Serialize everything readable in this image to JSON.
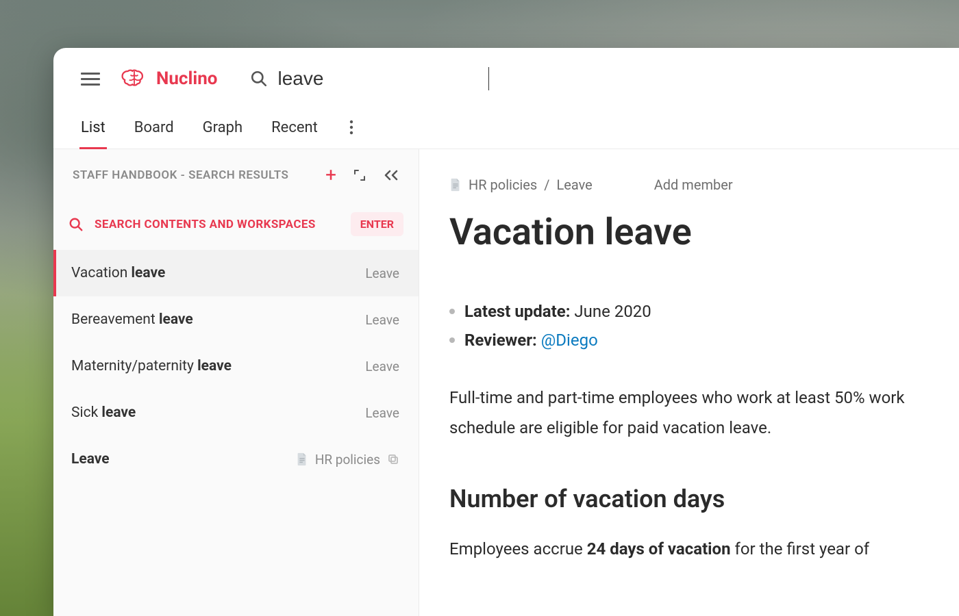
{
  "brand": {
    "name": "Nuclino"
  },
  "search": {
    "query": "leave"
  },
  "tabs": [
    "List",
    "Board",
    "Graph",
    "Recent"
  ],
  "active_tab_index": 0,
  "sidebar": {
    "header": "STAFF HANDBOOK - SEARCH RESULTS",
    "search_all_label": "SEARCH CONTENTS AND WORKSPACES",
    "enter_label": "ENTER",
    "results": [
      {
        "title_pre": "Vacation ",
        "title_bold": "leave",
        "crumb": "Leave",
        "active": true
      },
      {
        "title_pre": "Bereavement ",
        "title_bold": "leave",
        "crumb": "Leave",
        "active": false
      },
      {
        "title_pre": "Maternity/paternity ",
        "title_bold": "leave",
        "crumb": "Leave",
        "active": false
      },
      {
        "title_pre": "Sick ",
        "title_bold": "leave",
        "crumb": "Leave",
        "active": false
      },
      {
        "title_pre": "Leave",
        "title_bold": "",
        "crumb": "HR policies",
        "has_doc_icon": true,
        "has_copy_icon": true,
        "title_is_bold": true
      }
    ]
  },
  "document": {
    "breadcrumb": [
      "HR policies",
      "Leave"
    ],
    "add_member_label": "Add member",
    "title": "Vacation leave",
    "meta": {
      "latest_update_label": "Latest update:",
      "latest_update_value": "June 2020",
      "reviewer_label": "Reviewer:",
      "reviewer_mention": "@Diego"
    },
    "intro": "Full-time and part-time employees who work at least 50% work schedule are eligible for paid vacation leave.",
    "section_heading": "Number of vacation days",
    "section_body_pre": "Employees accrue ",
    "section_body_bold": "24 days of vacation",
    "section_body_post": " for the first year of"
  }
}
